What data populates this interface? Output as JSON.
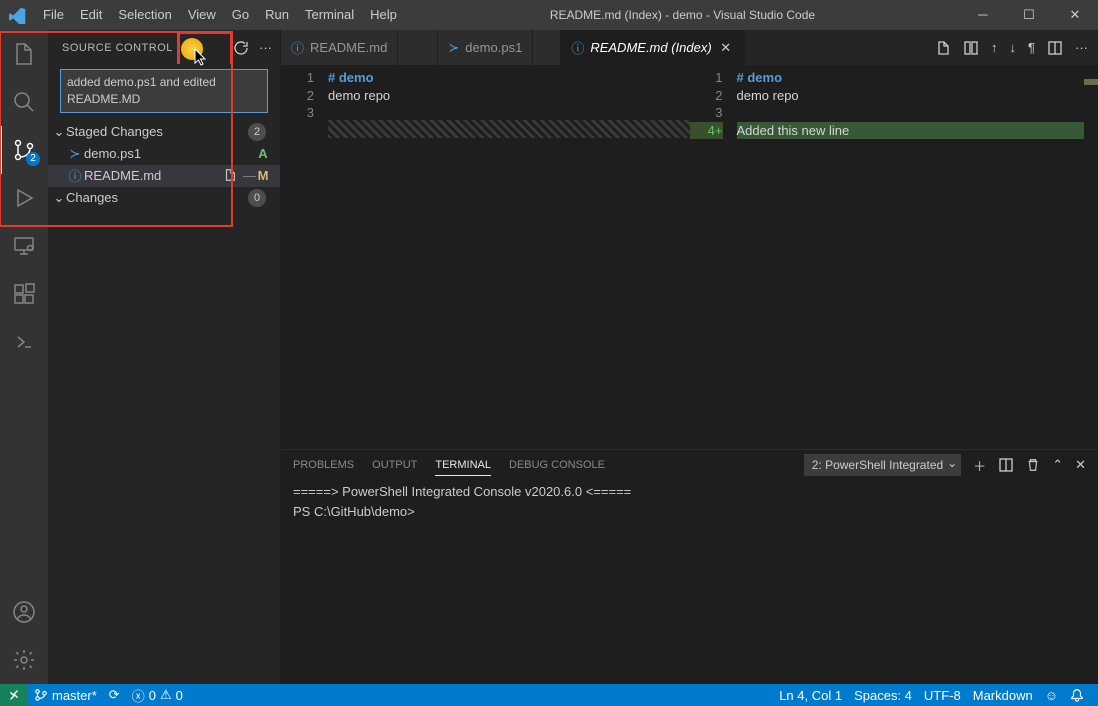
{
  "title": "README.md (Index) - demo - Visual Studio Code",
  "menu": {
    "items": [
      "File",
      "Edit",
      "Selection",
      "View",
      "Go",
      "Run",
      "Terminal",
      "Help"
    ]
  },
  "activity_badge": "2",
  "sidebar": {
    "title": "SOURCE CONTROL",
    "commit_message": "added demo.ps1 and edited README.MD",
    "sections": [
      {
        "label": "Staged Changes",
        "count": "2"
      },
      {
        "label": "Changes",
        "count": "0"
      }
    ],
    "staged": [
      {
        "name": "demo.ps1",
        "status": "A",
        "has_actions": false
      },
      {
        "name": "README.md",
        "status": "M",
        "has_actions": true
      }
    ]
  },
  "tabs": [
    {
      "label": "README.md",
      "active": false
    },
    {
      "label": "demo.ps1",
      "active": false
    },
    {
      "label": "README.md (Index)",
      "active": true,
      "italic": true
    }
  ],
  "editor_left": {
    "lines": [
      {
        "n": "1",
        "text": "# demo",
        "cls": "head"
      },
      {
        "n": "2",
        "text": "demo repo"
      },
      {
        "n": "3",
        "text": ""
      }
    ]
  },
  "editor_right": {
    "lines": [
      {
        "n": "1",
        "text": "# demo",
        "cls": "head"
      },
      {
        "n": "2",
        "text": "demo repo"
      },
      {
        "n": "3",
        "text": ""
      },
      {
        "n": "4+",
        "text": "Added this new line",
        "cls": "mod"
      }
    ]
  },
  "panel": {
    "tabs": [
      "PROBLEMS",
      "OUTPUT",
      "TERMINAL",
      "DEBUG CONSOLE"
    ],
    "active_tab": "TERMINAL",
    "select": "2: PowerShell Integrated",
    "lines": [
      "=====> PowerShell Integrated Console v2020.6.0 <=====",
      "",
      "PS C:\\GitHub\\demo>"
    ]
  },
  "status": {
    "branch": "master*",
    "sync": "⟳",
    "errors": "0",
    "warnings": "0",
    "line_col": "Ln 4, Col 1",
    "spaces": "Spaces: 4",
    "encoding": "UTF-8",
    "language": "Markdown"
  }
}
